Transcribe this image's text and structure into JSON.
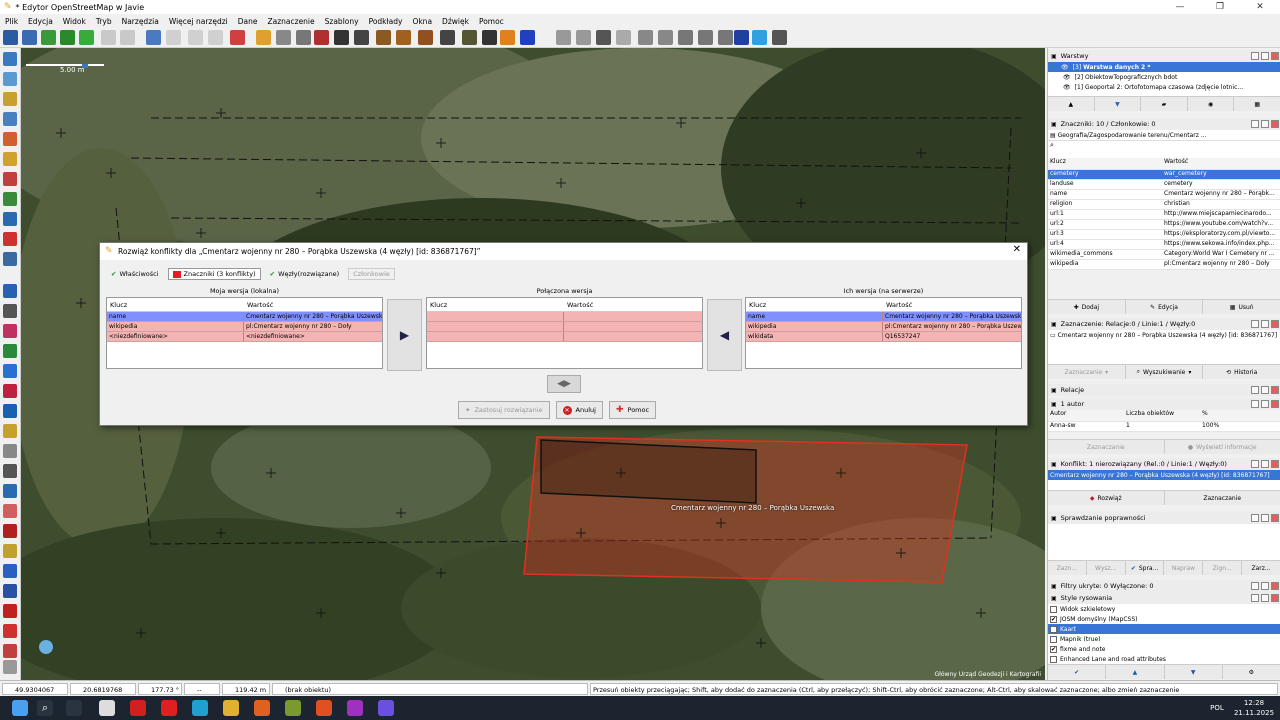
{
  "window": {
    "title": "* Edytor OpenStreetMap w Javie",
    "minimize": "—",
    "maximize": "❐",
    "close": "✕"
  },
  "menu": [
    "Plik",
    "Edycja",
    "Widok",
    "Tryb",
    "Narzędzia",
    "Więcej narzędzi",
    "Dane",
    "Zaznaczenie",
    "Szablony",
    "Podkłady",
    "Okna",
    "Dźwięk",
    "Pomoc"
  ],
  "map": {
    "scale_label": "5.00 m",
    "object_label": "Cmentarz wojenny nr 280 – Porąbka Uszewska",
    "credit": "Główny Urząd Geodezji i Kartografii"
  },
  "dialog": {
    "title": "Rozwiąż konflikty dla „Cmentarz wojenny nr 280 – Porąbka Uszewska (4 węzły) [id: 836871767]”",
    "tabs": [
      {
        "label": "Właściwości",
        "state": "normal"
      },
      {
        "label": "Znaczniki (3 konflikty)",
        "state": "selected"
      },
      {
        "label": "Węzły(rozwiązane)",
        "state": "normal"
      },
      {
        "label": "Członkowie",
        "state": "disabled"
      }
    ],
    "my_title": "Moja wersja (lokalna)",
    "merged_title": "Połączona wersja",
    "their_title": "Ich wersja (na serwerze)",
    "col_key": "Klucz",
    "col_value": "Wartość",
    "my_rows": [
      {
        "key": "name",
        "value": "Cmentarz wojenny nr 280 – Porąbka Uszewska",
        "style": "blue"
      },
      {
        "key": "wikipedia",
        "value": "pl:Cmentarz wojenny nr 280 – Doły",
        "style": "pink"
      },
      {
        "key": "<niezdefiniowane>",
        "value": "<niezdefiniowane>",
        "style": "pink"
      }
    ],
    "their_rows": [
      {
        "key": "name",
        "value": "Cmentarz wojenny nr 280 – Porąbka Uszewska",
        "style": "blue"
      },
      {
        "key": "wikipedia",
        "value": "pl:Cmentarz wojenny nr 280 – Porąbka Uszewska",
        "style": "pink"
      },
      {
        "key": "wikidata",
        "value": "Q16537247",
        "style": "pink"
      }
    ],
    "btn_apply": "Zastosuj rozwiązanie",
    "btn_cancel": "Anuluj",
    "btn_help": "Pomoc"
  },
  "layers": {
    "title": "Warstwy",
    "items": [
      {
        "num": "[3]",
        "name": "Warstwa danych 2 *",
        "selected": true
      },
      {
        "num": "[2]",
        "name": "ObiektowTopograficznych bdot",
        "selected": false
      },
      {
        "num": "[1]",
        "name": "Geoportal 2: Ortofotomapa czasowa (zdjęcie lotnic...",
        "selected": false
      }
    ]
  },
  "tags": {
    "title": "Znaczniki: 10 / Członkowie: 0",
    "preset": "Geografia/Zagospodarowanie terenu/Cmentarz ...",
    "col_key": "Klucz",
    "col_value": "Wartość",
    "rows": [
      {
        "k": "cemetery",
        "v": "war_cemetery",
        "sel": true
      },
      {
        "k": "landuse",
        "v": "cemetery",
        "sel": false
      },
      {
        "k": "name",
        "v": "Cmentarz wojenny nr 280 – Porąbk...",
        "sel": false
      },
      {
        "k": "religion",
        "v": "christian",
        "sel": false
      },
      {
        "k": "url:1",
        "v": "http://www.miejscapamiecinarodo...",
        "sel": false
      },
      {
        "k": "url:2",
        "v": "https://www.youtube.com/watch?v...",
        "sel": false
      },
      {
        "k": "url:3",
        "v": "https://eksploratorzy.com.pl/viewto...",
        "sel": false
      },
      {
        "k": "url:4",
        "v": "https://www.sekowa.info/index.php...",
        "sel": false
      },
      {
        "k": "wikimedia_commons",
        "v": "Category:World War I Cemetery nr ...",
        "sel": false
      },
      {
        "k": "wikipedia",
        "v": "pl:Cmentarz wojenny nr 280 – Doły",
        "sel": false
      }
    ],
    "btn_add": "Dodaj",
    "btn_edit": "Edycja",
    "btn_delete": "Usuń"
  },
  "selection": {
    "title": "Zaznaczenie: Relacje:0 / Linie:1 / Węzły:0",
    "item": "Cmentarz wojenny nr 280 – Porąbka Uszewska (4 węzły) [id: 836871767]",
    "btn_select": "Zaznaczanie",
    "btn_search": "Wyszukiwanie",
    "btn_history": "Historia"
  },
  "relations": {
    "title": "Relacje"
  },
  "authors": {
    "title": "1 autor",
    "col_author": "Autor",
    "col_count": "Liczba obiektów",
    "col_pct": "%",
    "row": {
      "author": "Anna-sw",
      "count": "1",
      "pct": "100%"
    },
    "btn_select": "Zaznaczanie",
    "btn_info": "Wyświetl informacje"
  },
  "conflicts": {
    "title": "Konflikt: 1 nierozwiązany (Rel.:0 / Linie:1 / Węzły:0)",
    "item": "Cmentarz wojenny nr 280 – Porąbka Uszewska (4 węzły) [id: 836871767]",
    "btn_resolve": "Rozwiąż",
    "btn_select": "Zaznaczanie"
  },
  "validation": {
    "title": "Sprawdzanie poprawności",
    "buttons": [
      "Zazn...",
      "Wysz...",
      "Spra...",
      "Napraw",
      "Zign...",
      "Zarz..."
    ]
  },
  "filters": {
    "title": "Filtry ukryte: 0 Wyłączone: 0"
  },
  "styles": {
    "title": "Style rysowania",
    "items": [
      {
        "label": "Widok szkieletowy",
        "checked": false,
        "sel": false
      },
      {
        "label": "JOSM domyślny (MapCSS)",
        "checked": true,
        "sel": false
      },
      {
        "label": "Kaart",
        "checked": false,
        "sel": true
      },
      {
        "label": "Mapnik (true)",
        "checked": false,
        "sel": false
      },
      {
        "label": "fixme and note",
        "checked": true,
        "sel": false
      },
      {
        "label": "Enhanced Lane and road attributes",
        "checked": false,
        "sel": false
      }
    ]
  },
  "status": {
    "lat": "49.9304067",
    "lon": "20.6819768",
    "heading": "177.73 °",
    "angle": "--",
    "distance": "119.42 m",
    "object": "(brak obiektu)",
    "help": "Przesuń obiekty przeciągając; Shift, aby dodać do zaznaczenia (Ctrl, aby przełączyć); Shift-Ctrl, aby obrócić zaznaczone; Alt-Ctrl, aby skalować zaznaczone; albo zmień zaznaczenie"
  },
  "taskbar": {
    "lang": "POL",
    "time": "12:28",
    "date": "21.11.2025"
  },
  "colors": {
    "accent": "#3875d7",
    "conflict": "#f4b4b4",
    "blue_row": "#8090ff",
    "way_red": "#e03020"
  }
}
